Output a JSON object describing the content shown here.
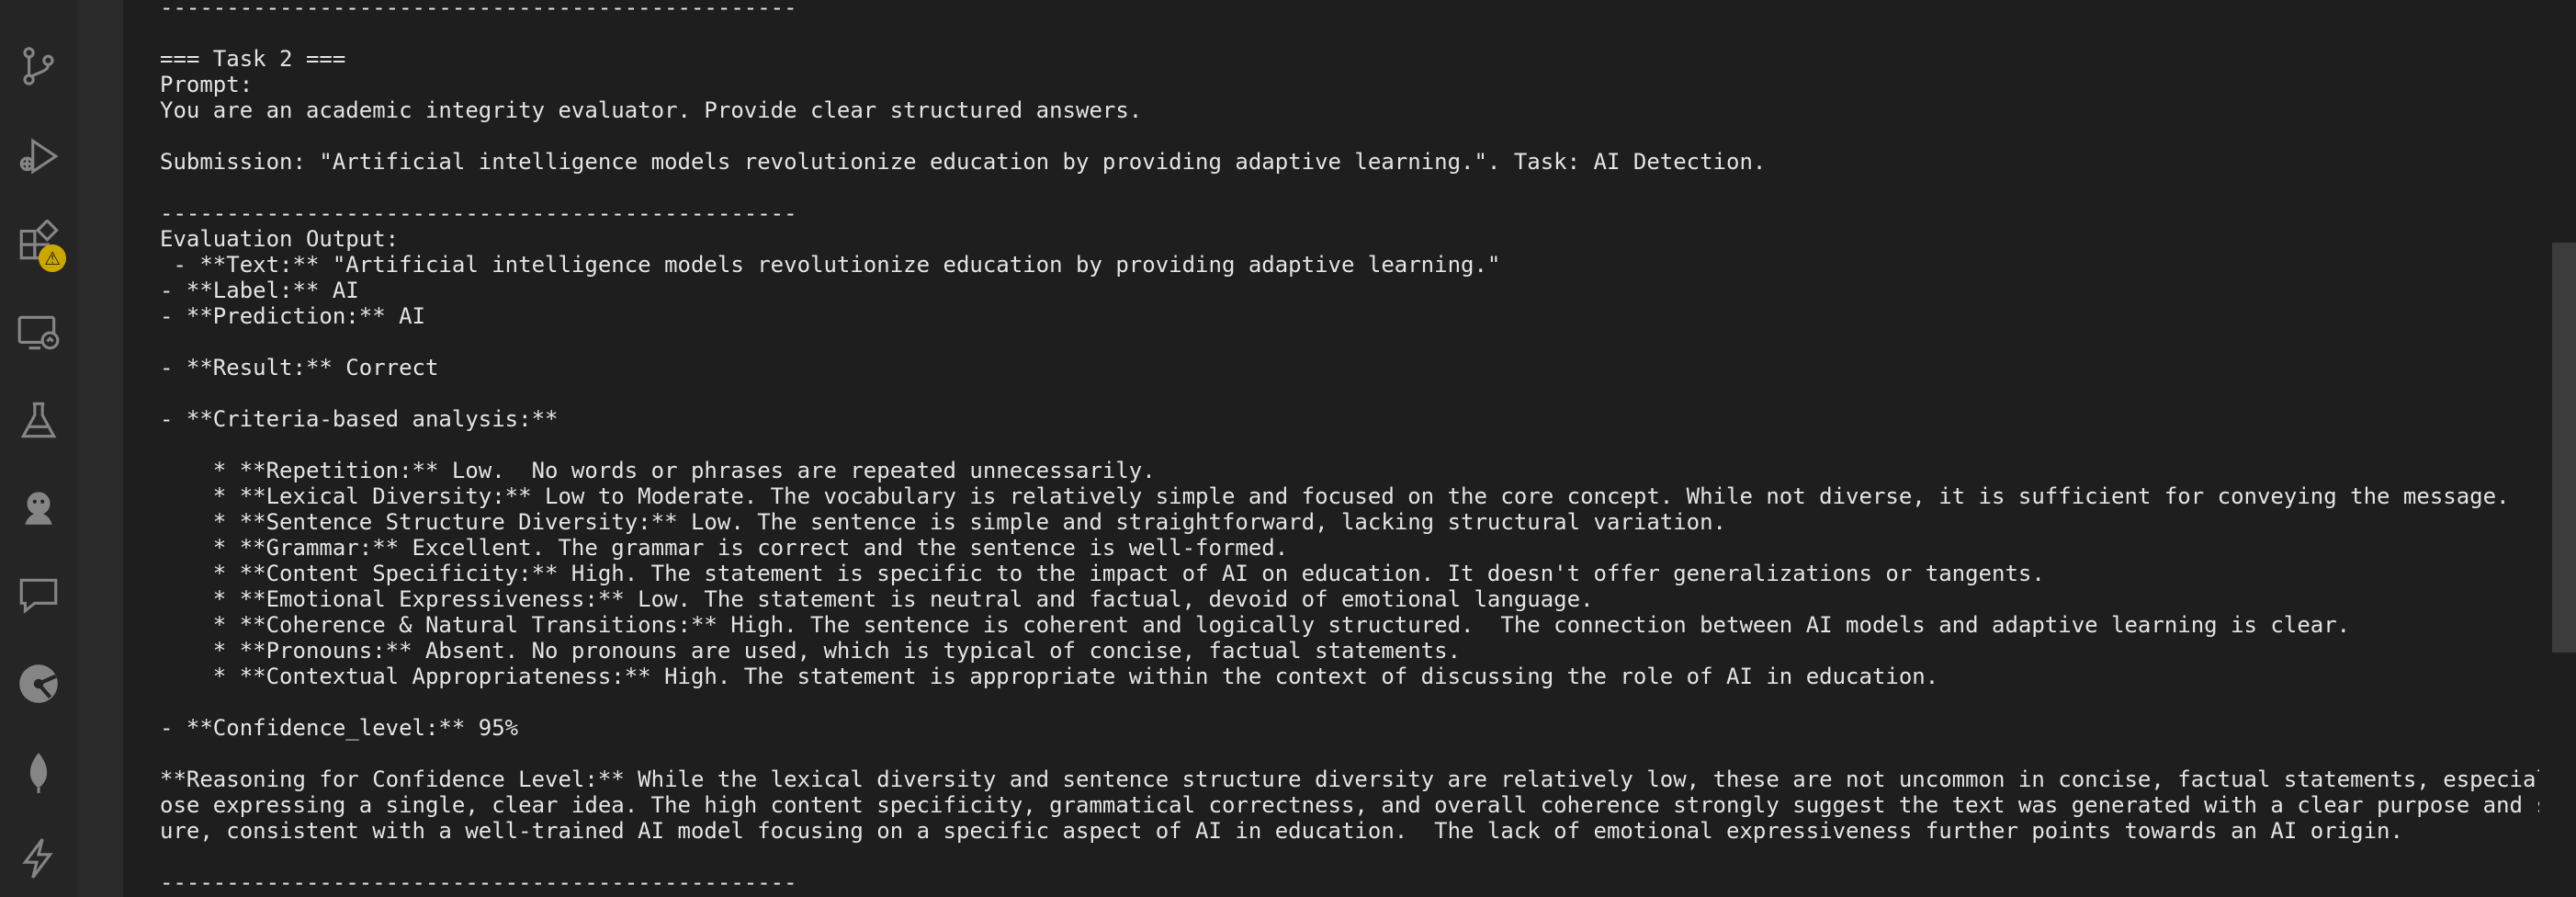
{
  "activity_bar": {
    "icons": [
      "source-control-icon",
      "run-debug-icon",
      "extensions-icon",
      "remote-explorer-icon",
      "testing-flask-icon",
      "jupyter-icon",
      "chat-icon",
      "gitlens-icon",
      "mongodb-leaf-icon",
      "lightning-icon"
    ],
    "extensions_badge": "⚠"
  },
  "output": {
    "lines": [
      "------------------------------------------------",
      "",
      "=== Task 2 ===",
      "Prompt:",
      "You are an academic integrity evaluator. Provide clear structured answers.",
      "",
      "Submission: \"Artificial intelligence models revolutionize education by providing adaptive learning.\". Task: AI Detection.",
      "",
      "------------------------------------------------",
      "Evaluation Output:",
      " - **Text:** \"Artificial intelligence models revolutionize education by providing adaptive learning.\"",
      "- **Label:** AI",
      "- **Prediction:** AI",
      "",
      "- **Result:** Correct",
      "",
      "- **Criteria-based analysis:**",
      "",
      "    * **Repetition:** Low.  No words or phrases are repeated unnecessarily.",
      "    * **Lexical Diversity:** Low to Moderate. The vocabulary is relatively simple and focused on the core concept. While not diverse, it is sufficient for conveying the message.",
      "    * **Sentence Structure Diversity:** Low. The sentence is simple and straightforward, lacking structural variation.",
      "    * **Grammar:** Excellent. The grammar is correct and the sentence is well-formed.",
      "    * **Content Specificity:** High. The statement is specific to the impact of AI on education. It doesn't offer generalizations or tangents.",
      "    * **Emotional Expressiveness:** Low. The statement is neutral and factual, devoid of emotional language.",
      "    * **Coherence & Natural Transitions:** High. The sentence is coherent and logically structured.  The connection between AI models and adaptive learning is clear.",
      "    * **Pronouns:** Absent. No pronouns are used, which is typical of concise, factual statements.",
      "    * **Contextual Appropriateness:** High. The statement is appropriate within the context of discussing the role of AI in education.",
      "",
      "- **Confidence_level:** 95%",
      "",
      "**Reasoning for Confidence Level:** While the lexical diversity and sentence structure diversity are relatively low, these are not uncommon in concise, factual statements, especially th",
      "ose expressing a single, clear idea. The high content specificity, grammatical correctness, and overall coherence strongly suggest the text was generated with a clear purpose and struct",
      "ure, consistent with a well-trained AI model focusing on a specific aspect of AI in education.  The lack of emotional expressiveness further points towards an AI origin.",
      "",
      "------------------------------------------------"
    ]
  }
}
